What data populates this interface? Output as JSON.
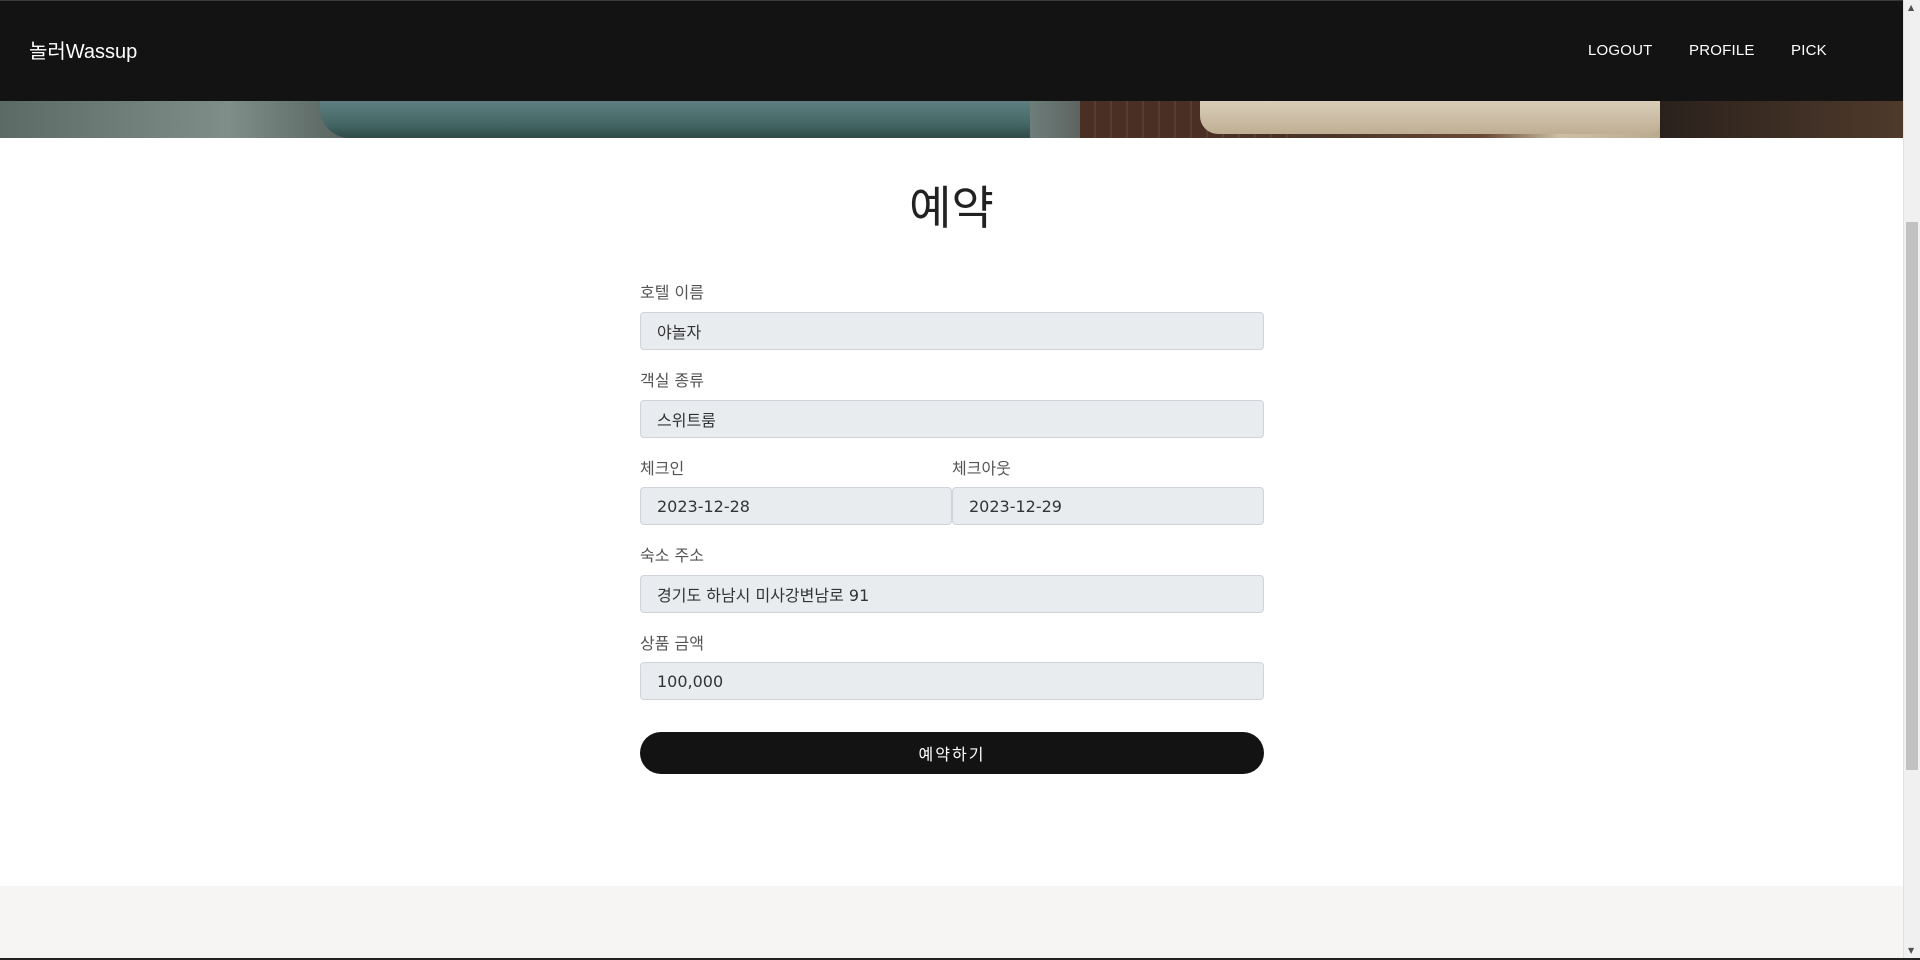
{
  "navbar": {
    "brand": "놀러Wassup",
    "links": [
      "LOGOUT",
      "PROFILE",
      "PICK"
    ]
  },
  "page": {
    "title": "예약"
  },
  "form": {
    "hotel_name": {
      "label": "호텔 이름",
      "value": "야놀자"
    },
    "room_type": {
      "label": "객실 종류",
      "value": "스위트룸"
    },
    "checkin": {
      "label": "체크인",
      "value": "2023-12-28"
    },
    "checkout": {
      "label": "체크아웃",
      "value": "2023-12-29"
    },
    "address": {
      "label": "숙소 주소",
      "value": "경기도 하남시 미사강변남로 91"
    },
    "price": {
      "label": "상품 금액",
      "value": "100,000"
    },
    "submit_label": "예약하기"
  },
  "colors": {
    "navbar_bg": "#131313",
    "field_bg": "#e9ecef",
    "button_bg": "#131313",
    "footer_bg": "#f6f5f3"
  }
}
